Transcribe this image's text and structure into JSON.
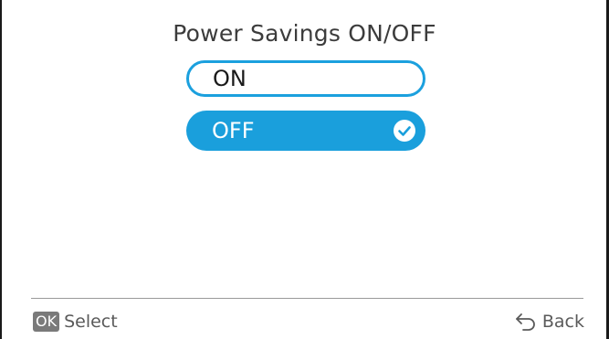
{
  "screen": {
    "title": "Power Savings ON/OFF"
  },
  "options": [
    {
      "label": "ON",
      "selected": false
    },
    {
      "label": "OFF",
      "selected": true
    }
  ],
  "footer": {
    "ok_badge": "OK",
    "select_label": "Select",
    "back_label": "Back"
  },
  "colors": {
    "accent": "#1a9fdc",
    "text": "#3c3c3c",
    "footer_text": "#5a5a5a",
    "badge_bg": "#7a7a7a"
  },
  "icons": {
    "check": "check-circle-icon",
    "back": "back-arrow-icon"
  }
}
